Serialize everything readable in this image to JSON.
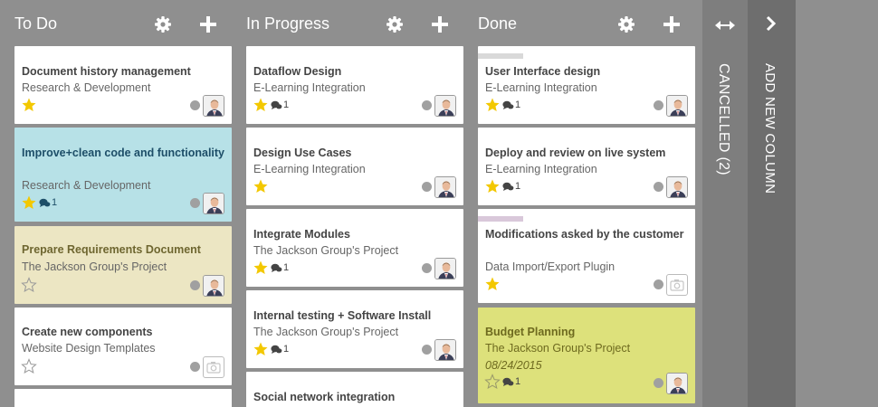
{
  "columns": [
    {
      "title": "To Do",
      "cards": [
        {
          "title": "Document history management",
          "subtitle": "Research & Development",
          "starred": true,
          "comments": "",
          "avatar": "photo"
        },
        {
          "title": "Improve+clean code and functionality",
          "subtitle": "Research & Development",
          "starred": true,
          "comments": "1",
          "avatar": "photo",
          "color": "blue"
        },
        {
          "title": "Prepare Requirements Document",
          "subtitle": "The Jackson Group's Project",
          "starred": false,
          "comments": "",
          "avatar": "photo",
          "color": "sand"
        },
        {
          "title": "Create new components",
          "subtitle": "Website Design Templates",
          "starred": false,
          "comments": "",
          "avatar": "placeholder"
        }
      ]
    },
    {
      "title": "In Progress",
      "cards": [
        {
          "title": "Dataflow Design",
          "subtitle": "E-Learning Integration",
          "starred": true,
          "comments": "1",
          "avatar": "photo"
        },
        {
          "title": "Design Use Cases",
          "subtitle": "E-Learning Integration",
          "starred": true,
          "comments": "",
          "avatar": "photo"
        },
        {
          "title": "Integrate Modules",
          "subtitle": "The Jackson Group's Project",
          "starred": true,
          "comments": "1",
          "avatar": "photo"
        },
        {
          "title": "Internal testing + Software Install",
          "subtitle": "The Jackson Group's Project",
          "starred": true,
          "comments": "1",
          "avatar": "photo"
        },
        {
          "title": "Social network integration"
        }
      ]
    },
    {
      "title": "Done",
      "cards": [
        {
          "title": "User Interface design",
          "subtitle": "E-Learning Integration",
          "starred": true,
          "comments": "1",
          "avatar": "photo",
          "bar_color": "#d9d9d9"
        },
        {
          "title": "Deploy and review on live system",
          "subtitle": "E-Learning Integration",
          "starred": true,
          "comments": "1",
          "avatar": "photo"
        },
        {
          "title": "Modifications asked by the customer",
          "subtitle": "Data Import/Export Plugin",
          "starred": true,
          "comments": "",
          "avatar": "placeholder",
          "bar_color": "#d9c8da"
        },
        {
          "title": "Budget Planning",
          "subtitle": "The Jackson Group's Project",
          "date": "08/24/2015",
          "starred": false,
          "comments": "1",
          "avatar": "photo",
          "color": "yellow"
        }
      ]
    }
  ],
  "folded": {
    "cancelled": "CANCELLED (2)",
    "add_column": "ADD NEW COLUMN"
  },
  "colors": {
    "background": "#8f8f8f",
    "star": "#f3c800",
    "blue_card": "#b7e1e7",
    "sand_card": "#ece6c3",
    "yellow_card": "#dde17b"
  }
}
